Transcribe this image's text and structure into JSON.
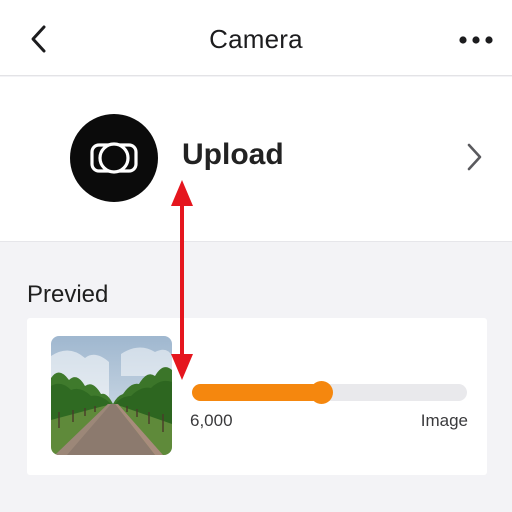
{
  "header": {
    "title": "Camera",
    "back_icon": "chevron-left-icon",
    "more_icon": "more-horizontal-icon"
  },
  "upload": {
    "label": "Upload",
    "icon": "camera-icon",
    "chevron_icon": "chevron-right-icon"
  },
  "preview": {
    "section_title": "Previed",
    "thumbnail": "tree-lined-road-photo",
    "progress_fraction": 0.47,
    "value_left": "6,000",
    "value_right": "Image"
  },
  "annotation": {
    "icon": "double-headed-arrow",
    "color": "#e5161e"
  },
  "colors": {
    "accent": "#f5870e",
    "background": "#f3f3f6",
    "surface": "#ffffff"
  }
}
